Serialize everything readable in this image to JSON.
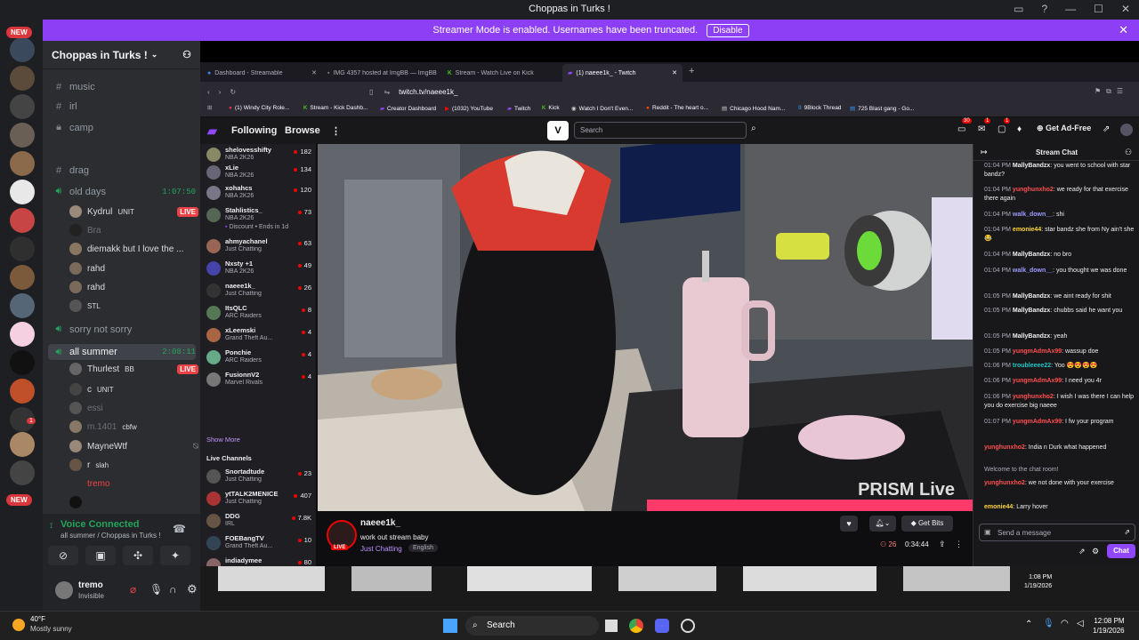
{
  "window": {
    "title": "Choppas in Turks !"
  },
  "banner": {
    "text": "Streamer Mode is enabled. Usernames have been truncated.",
    "disable_label": "Disable"
  },
  "rail": {
    "new_badge": "NEW",
    "new_badge2": "NEW",
    "count_badge": "1"
  },
  "server": {
    "name": "Choppas in Turks !"
  },
  "channels": [
    {
      "name": "music"
    },
    {
      "name": "irl"
    },
    {
      "name": "camp"
    },
    {
      "name": "drag"
    }
  ],
  "voice_channels": {
    "old_days": {
      "name": "old days",
      "timer": "1:07:50"
    },
    "sorry": {
      "name": "sorry not sorry"
    },
    "summer": {
      "name": "all summer",
      "timer": "2:08:11"
    }
  },
  "old_days_users": [
    {
      "name": "Kydrul",
      "tag": "UNIT",
      "live": "LIVE"
    },
    {
      "name": "Bra"
    },
    {
      "name": "diemakk but I love the ..."
    },
    {
      "name": "rahd"
    },
    {
      "name": "rahd"
    },
    {
      "name": "STL"
    }
  ],
  "summer_users": [
    {
      "name": "Thurlest",
      "tag": "BB",
      "live": "LIVE"
    },
    {
      "name": "c",
      "tag": "UNIT"
    },
    {
      "name": "essi"
    },
    {
      "name": "m.1401",
      "tag": "cbfw"
    },
    {
      "name": "MayneWtf"
    },
    {
      "name": "r",
      "tag": "slah"
    },
    {
      "name": "tremo"
    },
    {
      "name": ""
    }
  ],
  "voice": {
    "status": "Voice Connected",
    "location": "all summer / Choppas in Turks !"
  },
  "user": {
    "name": "tremo",
    "status": "Invisible"
  },
  "tabs": [
    {
      "label": "Dashboard - Streamable"
    },
    {
      "label": "IMG 4357 hosted at ImgBB — ImgBB"
    },
    {
      "label": "Stream - Watch Live on Kick"
    },
    {
      "label": "(1) naeee1k_ - Twitch"
    }
  ],
  "url": "twitch.tv/naeee1k_",
  "bookmarks": [
    {
      "label": "(1) Windy City Role..."
    },
    {
      "label": "Stream - Kick Dashb..."
    },
    {
      "label": "Creator Dashboard"
    },
    {
      "label": "(1032) YouTube"
    },
    {
      "label": "Twitch"
    },
    {
      "label": "Kick"
    },
    {
      "label": "Watch I Don't Even..."
    },
    {
      "label": "Reddit - The heart o..."
    },
    {
      "label": "Chicago Hood Nam..."
    },
    {
      "label": "9Block Thread"
    },
    {
      "label": "725 Blast gang - Go..."
    }
  ],
  "twitch_nav": {
    "following": "Following",
    "browse": "Browse",
    "search_placeholder": "Search",
    "get_ad_free": "Get Ad-Free",
    "badge1": "30",
    "badge2": "1",
    "badge3": "1"
  },
  "followed": [
    {
      "name": "shelovesshifty",
      "game": "NBA 2K26",
      "viewers": "182"
    },
    {
      "name": "xLie",
      "game": "NBA 2K26",
      "viewers": "134"
    },
    {
      "name": "xohahcs",
      "game": "NBA 2K26",
      "viewers": "120"
    },
    {
      "name": "Stahlistics_",
      "game": "NBA 2K26",
      "viewers": "73"
    },
    {
      "name": "",
      "game": "Discount • Ends in 1d",
      "viewers": ""
    },
    {
      "name": "ahmyachanel",
      "game": "Just Chatting",
      "viewers": "63"
    },
    {
      "name": "Nxsty +1",
      "game": "NBA 2K26",
      "viewers": "49"
    },
    {
      "name": "naeee1k_",
      "game": "Just Chatting",
      "viewers": "26"
    },
    {
      "name": "ItsQLC",
      "game": "ARC Raiders",
      "viewers": "8"
    },
    {
      "name": "xLeemski",
      "game": "Grand Theft Au...",
      "viewers": "4"
    },
    {
      "name": "Ponchie",
      "game": "ARC Raiders",
      "viewers": "4"
    },
    {
      "name": "FusionnV2",
      "game": "Marvel Rivals",
      "viewers": "4"
    }
  ],
  "show_more": "Show More",
  "live_channels_title": "Live Channels",
  "live_channels": [
    {
      "name": "Snortadtude",
      "game": "Just Chatting",
      "viewers": "23"
    },
    {
      "name": "ytTALK2MENICE",
      "game": "Just Chatting",
      "viewers": "407"
    },
    {
      "name": "DDG",
      "game": "IRL",
      "viewers": "7.8K"
    },
    {
      "name": "FOEBangTV",
      "game": "Grand Theft Au...",
      "viewers": "10"
    },
    {
      "name": "indiadymee",
      "game": "Madden NFL 26",
      "viewers": "80"
    },
    {
      "name": "melaniericch",
      "game": "Just Chatting",
      "viewers": "34"
    }
  ],
  "show_more2": "Show More",
  "stream": {
    "channel": "naeee1k_",
    "title": "work out stream baby",
    "category": "Just Chatting",
    "tag": "English",
    "live": "LIVE",
    "viewers": "26",
    "uptime": "0:34:44",
    "get_bits": "Get Bits",
    "overlay": "PRISM Live"
  },
  "chat": {
    "title": "Stream Chat",
    "messages": [
      {
        "time": "01:04 PM",
        "user": "MallyBandzx",
        "text": "you went to school with star bandz?",
        "color": "#ffffff"
      },
      {
        "time": "01:04 PM",
        "user": "yunghunxho2",
        "text": "we ready for that exercise there again",
        "color": "#ff4f4f"
      },
      {
        "time": "01:04 PM",
        "user": "walk_down__",
        "text": "shi",
        "color": "#9b9bff"
      },
      {
        "time": "01:04 PM",
        "user": "emonie44",
        "text": "star bandz she from Ny ain't she 😂",
        "color": "#ffd43b"
      },
      {
        "time": "01:04 PM",
        "user": "MallyBandzx",
        "text": "no bro",
        "color": "#ffffff"
      },
      {
        "time": "01:04 PM",
        "user": "walk_down__",
        "text": "you thought we was done",
        "color": "#9b9bff"
      },
      {
        "time": "01:05 PM",
        "user": "MallyBandzx",
        "text": "we aint ready for shit",
        "color": "#ffffff"
      },
      {
        "time": "01:05 PM",
        "user": "MallyBandzx",
        "text": "chubbs said he want you",
        "color": "#ffffff"
      },
      {
        "time": "01:05 PM",
        "user": "MallyBandzx",
        "text": "yeah",
        "color": "#ffffff"
      },
      {
        "time": "01:05 PM",
        "user": "yungmAdmAx99",
        "text": "wassup doe",
        "color": "#ff4f4f"
      },
      {
        "time": "01:06 PM",
        "user": "troubleeee22",
        "text": "Yoo 😍😍😍😍",
        "color": "#1fc7c7"
      },
      {
        "time": "01:06 PM",
        "user": "yungmAdmAx99",
        "text": "I need you 4r",
        "color": "#ff4f4f"
      },
      {
        "time": "01:06 PM",
        "user": "yunghunxho2",
        "text": "I wish I was there I can help you do exercise big naeee",
        "color": "#ff4f4f"
      },
      {
        "time": "01:07 PM",
        "user": "yungmAdmAx99",
        "text": "I fw your program",
        "color": "#ff4f4f"
      },
      {
        "time": "",
        "user": "yunghunxho2",
        "text": "India n Durk what happened",
        "color": "#ff4f4f"
      },
      {
        "time": "",
        "user": "",
        "text": "Welcome to the chat room!",
        "color": "#adadb8"
      },
      {
        "time": "",
        "user": "yunghunxho2",
        "text": "we not done with your exercise",
        "color": "#ff4f4f"
      },
      {
        "time": "",
        "user": "emonie44",
        "text": "Larry hover",
        "color": "#ffd43b"
      }
    ],
    "input_placeholder": "Send a message",
    "chat_button": "Chat"
  },
  "taskbar": {
    "temp": "40°F",
    "weather": "Mostly sunny",
    "search": "Search",
    "time": "12:08 PM",
    "date": "1/19/2026",
    "tray_time": "1:08 PM",
    "tray_date": "1/19/2026"
  }
}
